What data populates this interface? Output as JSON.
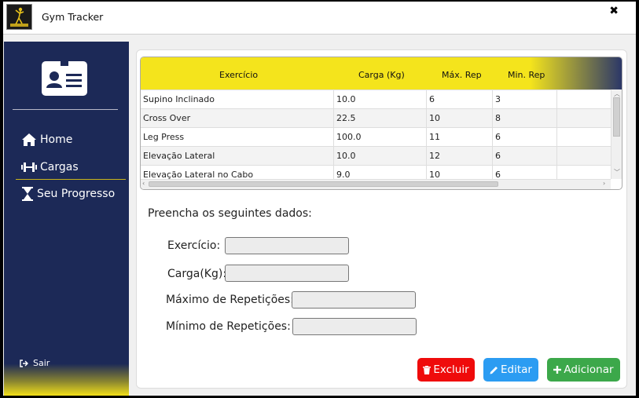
{
  "window": {
    "title": "Gym Tracker",
    "close_icon": "close-icon"
  },
  "sidebar": {
    "nav": [
      {
        "label": "Home",
        "icon": "home-icon"
      },
      {
        "label": "Cargas",
        "icon": "dumbbell-icon"
      },
      {
        "label": "Seu Progresso",
        "icon": "hourglass-icon"
      }
    ],
    "logout_label": "Sair",
    "accent_color": "#f2df1a",
    "bg_color": "#1c2957"
  },
  "table": {
    "columns": [
      "Exercício",
      "Carga (Kg)",
      "Máx. Rep",
      "Min. Rep"
    ],
    "rows": [
      [
        "Supino Inclinado",
        "10.0",
        "6",
        "3"
      ],
      [
        "Cross Over",
        "22.5",
        "10",
        "8"
      ],
      [
        "Leg Press",
        "100.0",
        "11",
        "6"
      ],
      [
        "Elevação Lateral",
        "10.0",
        "12",
        "6"
      ],
      [
        "Elevação Lateral no Cabo",
        "9.0",
        "10",
        "6"
      ]
    ]
  },
  "form": {
    "title": "Preencha os seguintes dados:",
    "fields": [
      {
        "label": "Exercício:",
        "value": ""
      },
      {
        "label": "Carga(Kg):",
        "value": ""
      },
      {
        "label": "Máximo de Repetições:",
        "value": ""
      },
      {
        "label": "Mínimo de Repetições:",
        "value": ""
      }
    ]
  },
  "buttons": {
    "delete": {
      "label": "Excluir",
      "color": "#ef0b0b",
      "icon": "trash-icon"
    },
    "edit": {
      "label": "Editar",
      "color": "#2b9cf2",
      "icon": "pencil-icon"
    },
    "add": {
      "label": "Adicionar",
      "color": "#3ca84a",
      "icon": "plus-icon"
    }
  }
}
